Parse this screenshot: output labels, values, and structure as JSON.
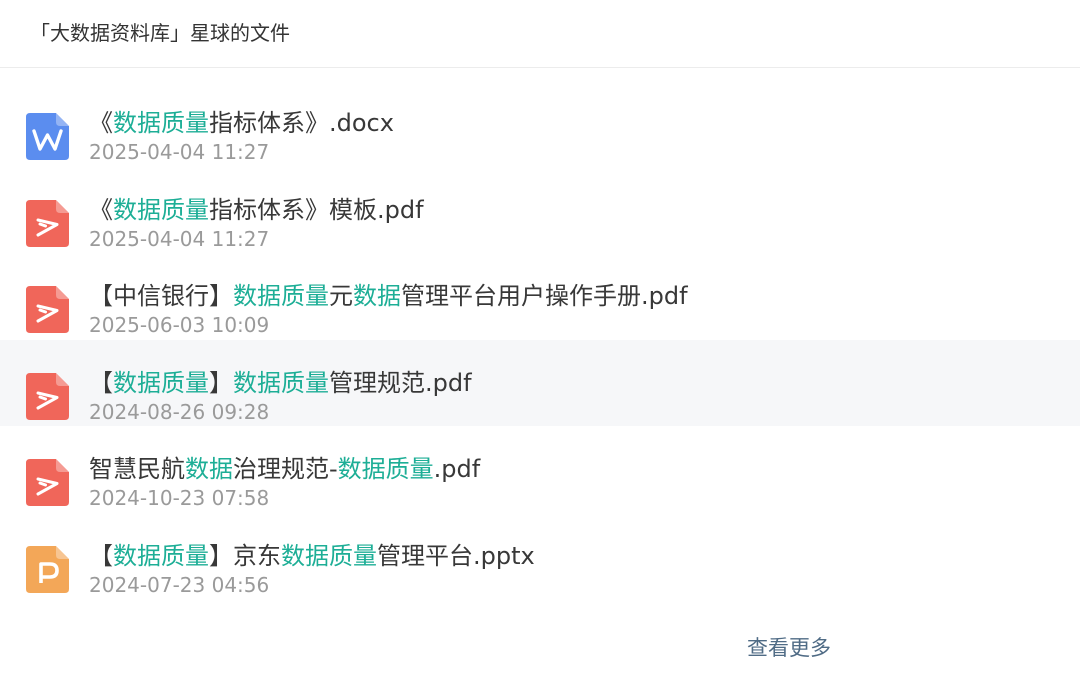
{
  "header": {
    "title": "「大数据资料库」星球的文件"
  },
  "colors": {
    "highlight": "#1dae96",
    "word": "#5b8def",
    "pdf": "#f0665a",
    "ppt": "#f3a758",
    "hover_bg": "#f6f7f9"
  },
  "files": [
    {
      "type": "docx",
      "icon": "word-doc-icon",
      "name_parts": [
        {
          "text": "《",
          "hl": false
        },
        {
          "text": "数据质量",
          "hl": true
        },
        {
          "text": "指标体系》.docx",
          "hl": false
        }
      ],
      "time": "2025-04-04 11:27",
      "hovered": false
    },
    {
      "type": "pdf",
      "icon": "pdf-doc-icon",
      "name_parts": [
        {
          "text": "《",
          "hl": false
        },
        {
          "text": "数据质量",
          "hl": true
        },
        {
          "text": "指标体系》模板.pdf",
          "hl": false
        }
      ],
      "time": "2025-04-04 11:27",
      "hovered": false
    },
    {
      "type": "pdf",
      "icon": "pdf-doc-icon",
      "name_parts": [
        {
          "text": "【中信银行】",
          "hl": false
        },
        {
          "text": "数据质量",
          "hl": true
        },
        {
          "text": "元",
          "hl": false
        },
        {
          "text": "数据",
          "hl": true
        },
        {
          "text": "管理平台用户操作手册.pdf",
          "hl": false
        }
      ],
      "time": "2025-06-03 10:09",
      "hovered": false
    },
    {
      "type": "pdf",
      "icon": "pdf-doc-icon",
      "name_parts": [
        {
          "text": "【",
          "hl": false
        },
        {
          "text": "数据质量",
          "hl": true
        },
        {
          "text": "】",
          "hl": false
        },
        {
          "text": "数据质量",
          "hl": true
        },
        {
          "text": "管理规范.pdf",
          "hl": false
        }
      ],
      "time": "2024-08-26 09:28",
      "hovered": true
    },
    {
      "type": "pdf",
      "icon": "pdf-doc-icon",
      "name_parts": [
        {
          "text": "智慧民航",
          "hl": false
        },
        {
          "text": "数据",
          "hl": true
        },
        {
          "text": "治理规范-",
          "hl": false
        },
        {
          "text": "数据质量",
          "hl": true
        },
        {
          "text": ".pdf",
          "hl": false
        }
      ],
      "time": "2024-10-23 07:58",
      "hovered": false
    },
    {
      "type": "pptx",
      "icon": "ppt-doc-icon",
      "name_parts": [
        {
          "text": "【",
          "hl": false
        },
        {
          "text": "数据质量",
          "hl": true
        },
        {
          "text": "】京东",
          "hl": false
        },
        {
          "text": "数据质量",
          "hl": true
        },
        {
          "text": "管理平台.pptx",
          "hl": false
        }
      ],
      "time": "2024-07-23 04:56",
      "hovered": false
    }
  ],
  "footer": {
    "more_label": "查看更多"
  }
}
